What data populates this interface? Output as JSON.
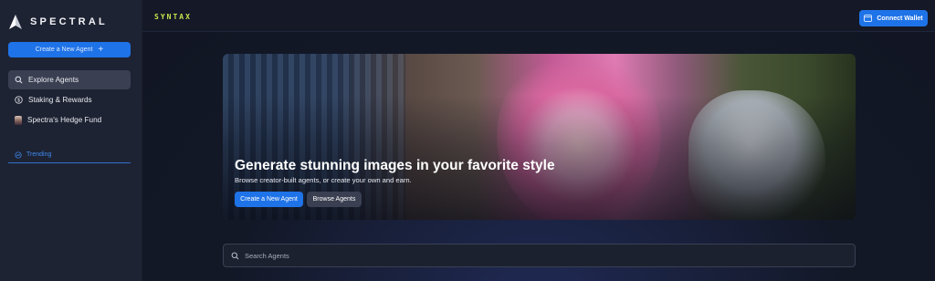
{
  "brand": {
    "name": "SPECTRAL",
    "logo_icon": "spectral-logo-icon"
  },
  "sidebar": {
    "create_label": "Create a New Agent",
    "create_icon": "plus-icon",
    "items": [
      {
        "label": "Explore Agents",
        "icon": "search-icon",
        "active": true
      },
      {
        "label": "Staking & Rewards",
        "icon": "dollar-circle-icon",
        "active": false
      },
      {
        "label": "Spectra's Hedge Fund",
        "icon": "avatar",
        "active": false
      }
    ],
    "trending_label": "Trending",
    "trending_icon": "trending-icon"
  },
  "topbar": {
    "app_label": "SYNTAX",
    "connect_label": "Connect Wallet",
    "connect_icon": "wallet-icon"
  },
  "hero": {
    "title": "Generate stunning images in your favorite style",
    "subtitle": "Browse creator-built agents, or create your own and earn.",
    "primary_button": "Create a New Agent",
    "secondary_button": "Browse Agents"
  },
  "search": {
    "placeholder": "Search Agents",
    "value": "",
    "icon": "search-icon"
  },
  "colors": {
    "accent": "#1f73e8",
    "brand_lime": "#c9e64d",
    "sidebar_bg": "#1e2333",
    "main_bg": "#131827"
  }
}
